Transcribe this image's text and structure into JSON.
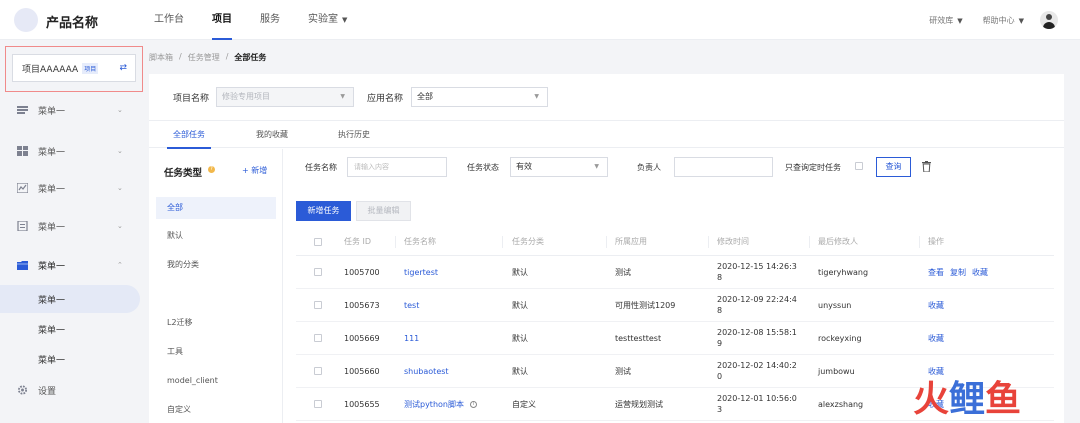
{
  "header": {
    "product_name": "产品名称",
    "nav": [
      "工作台",
      "项目",
      "服务",
      "实验室"
    ],
    "nav_active_index": 1,
    "right_items": [
      "研效库",
      "帮助中心"
    ]
  },
  "sidebar": {
    "project": {
      "name": "项目AAAAAA",
      "tag": "项目"
    },
    "menus": [
      {
        "label": "菜单一",
        "icon": "list-icon"
      },
      {
        "label": "菜单一",
        "icon": "grid-icon"
      },
      {
        "label": "菜单一",
        "icon": "chart-icon"
      },
      {
        "label": "菜单一",
        "icon": "document-icon"
      },
      {
        "label": "菜单一",
        "icon": "folder-icon",
        "open": true
      }
    ],
    "submenu": [
      {
        "label": "菜单一",
        "active": true
      },
      {
        "label": "菜单一"
      },
      {
        "label": "菜单一"
      }
    ],
    "settings": {
      "label": "设置",
      "icon": "settings-icon"
    }
  },
  "breadcrumb": [
    "脚本箱",
    "任务管理",
    "全部任务"
  ],
  "filters": {
    "project_label": "项目名称",
    "project_placeholder": "修验专用项目",
    "app_label": "应用名称",
    "app_value": "全部"
  },
  "tabs": [
    "全部任务",
    "我的收藏",
    "执行历史"
  ],
  "task_types": {
    "title": "任务类型",
    "add_label": "+ 新增",
    "items": [
      "全部",
      "默认",
      "我的分类",
      "L2迁移",
      "工具",
      "model_client",
      "自定义"
    ]
  },
  "search": {
    "name_label": "任务名称",
    "name_placeholder": "请输入内容",
    "status_label": "任务状态",
    "status_value": "有效",
    "owner_label": "负责人",
    "owner_value": "",
    "scheduled_label": "只查询定时任务",
    "query_label": "查询"
  },
  "actions": {
    "new_task": "新增任务",
    "batch_edit": "批量编辑"
  },
  "table": {
    "columns": [
      "任务 ID",
      "任务名称",
      "任务分类",
      "所属应用",
      "修改时间",
      "最后修改人",
      "操作"
    ],
    "rows": [
      {
        "id": "1005700",
        "name": "tigertest",
        "category": "默认",
        "app": "测试",
        "time": "2020-12-15 14:26:38",
        "modifier": "tigeryhwang",
        "ops": [
          "查看",
          "复制",
          "收藏"
        ]
      },
      {
        "id": "1005673",
        "name": "test",
        "category": "默认",
        "app": "可用性测试1209",
        "time": "2020-12-09 22:24:48",
        "modifier": "unyssun",
        "ops": [
          "收藏"
        ]
      },
      {
        "id": "1005669",
        "name": "111",
        "category": "默认",
        "app": "testtesttest",
        "time": "2020-12-08 15:58:19",
        "modifier": "rockeyxing",
        "ops": [
          "收藏"
        ]
      },
      {
        "id": "1005660",
        "name": "shubaotest",
        "category": "默认",
        "app": "测试",
        "time": "2020-12-02 14:40:20",
        "modifier": "jumbowu",
        "ops": [
          "收藏"
        ]
      },
      {
        "id": "1005655",
        "name": "测试python脚本",
        "category": "自定义",
        "app": "运营规划测试",
        "time": "2020-12-01 10:56:03",
        "modifier": "alexzshang",
        "ops": [
          "收藏"
        ],
        "has_info": true
      }
    ]
  },
  "watermark": {
    "text": [
      "火",
      "鲤",
      "鱼"
    ],
    "colors": [
      "#e8433a",
      "#3b6fd8",
      "#e8433a"
    ]
  },
  "colors": {
    "accent": "#2b5bd7",
    "highlight_border": "#f08a8a"
  }
}
